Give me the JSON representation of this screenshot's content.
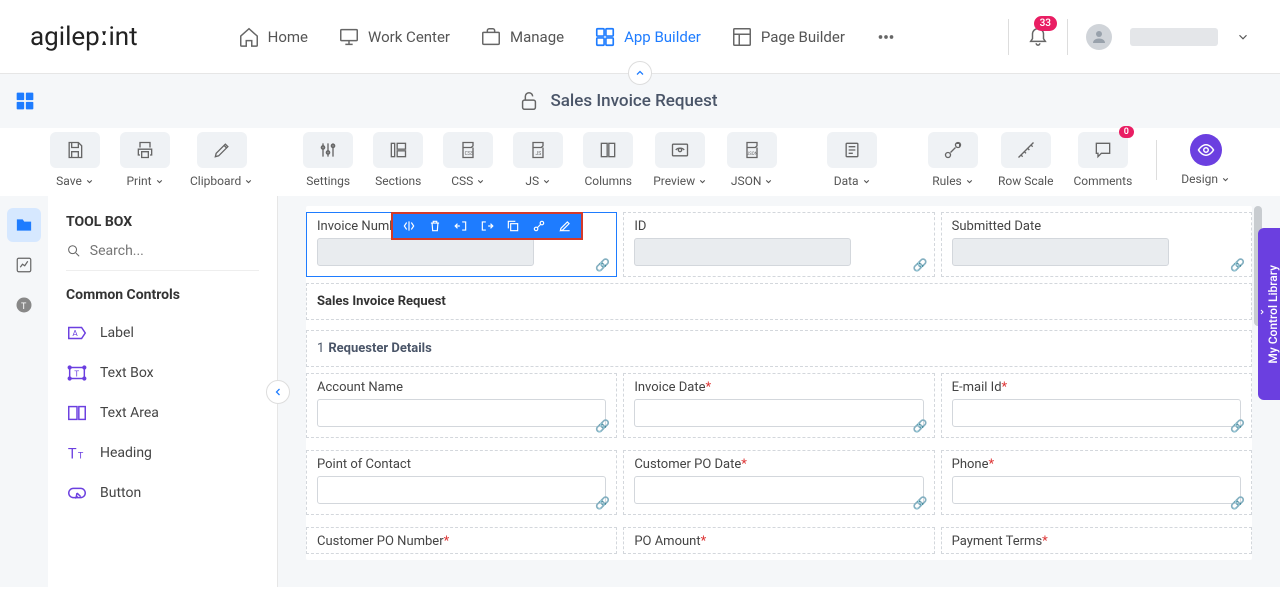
{
  "logo": {
    "pre": "agilep",
    "dot": "o",
    "post": "int"
  },
  "nav": {
    "home": "Home",
    "work_center": "Work Center",
    "manage": "Manage",
    "app_builder": "App Builder",
    "page_builder": "Page Builder"
  },
  "notifications": "33",
  "page_title": "Sales Invoice Request",
  "toolbar": {
    "save": "Save",
    "print": "Print",
    "clipboard": "Clipboard",
    "settings": "Settings",
    "sections": "Sections",
    "css": "CSS",
    "js": "JS",
    "columns": "Columns",
    "preview": "Preview",
    "json": "JSON",
    "data": "Data",
    "rules": "Rules",
    "row_scale": "Row Scale",
    "comments": "Comments",
    "comments_badge": "0",
    "design": "Design"
  },
  "sidebar": {
    "title": "TOOL BOX",
    "search_placeholder": "Search...",
    "section": "Common Controls",
    "items": [
      "Label",
      "Text Box",
      "Text Area",
      "Heading",
      "Button"
    ]
  },
  "form": {
    "row0": {
      "invoice_number": "Invoice Number",
      "id": "ID",
      "submitted_date": "Submitted Date"
    },
    "section_title": "Sales Invoice Request",
    "requester_section_num": "1",
    "requester_section": "Requester Details",
    "row1": {
      "account_name": "Account Name",
      "invoice_date": "Invoice Date",
      "email_id": "E-mail Id"
    },
    "row2": {
      "poc": "Point of Contact",
      "cust_po_date": "Customer PO Date",
      "phone": "Phone"
    },
    "row3": {
      "cust_po_num": "Customer PO Number",
      "po_amount": "PO Amount",
      "payment_terms": "Payment Terms"
    }
  },
  "right_tab": "My Control Library"
}
